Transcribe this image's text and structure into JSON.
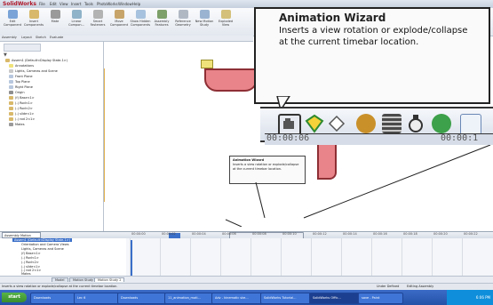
{
  "window": {
    "app_name": "SolidWorks",
    "menus": [
      "File",
      "Edit",
      "View",
      "Insert",
      "Tools",
      "PhotoWorks",
      "Window",
      "Help"
    ]
  },
  "command_manager": {
    "buttons": [
      {
        "label": "Edit Component"
      },
      {
        "label": "Insert Components"
      },
      {
        "label": "Mate"
      },
      {
        "label": "Linear Compon..."
      },
      {
        "label": "Smart Fasteners"
      },
      {
        "label": "Move Component"
      },
      {
        "label": "Show Hidden Components"
      },
      {
        "label": "Assembly Features"
      },
      {
        "label": "Reference Geometry"
      },
      {
        "label": "New Motion Study"
      },
      {
        "label": "Exploded View"
      }
    ],
    "tabs": [
      "Assembly",
      "Layout",
      "Sketch",
      "Evaluate"
    ]
  },
  "feature_tree": {
    "root": "Assem1 (Default<Display State-1>)",
    "items": [
      "Annotations",
      "Lights, Cameras and Scene",
      "Front Plane",
      "Top Plane",
      "Right Plane",
      "Origin",
      "(f) Base<1>",
      "(-) Rod<1>",
      "(-) Rod<2>",
      "(-) slide<1>",
      "(-) rod 2<1>",
      "Mates"
    ]
  },
  "callouts": {
    "big": {
      "title": "Animation Wizard",
      "description": "Inserts a view rotation or explode/collapse at the current timebar location."
    },
    "small": {
      "title": "Animation Wizard",
      "description": "Inserts a view rotation or explode/collapse at the current timebar location."
    }
  },
  "timebar_big_labels": [
    "00:00:06",
    "00:00:1"
  ],
  "motion_study": {
    "study_type": "Assembly Motion",
    "timeline_labels": [
      "00:00:00",
      "00:00:02",
      "00:00:04",
      "00:00:06",
      "00:00:08",
      "00:00:10",
      "00:00:12",
      "00:00:14",
      "00:00:16",
      "00:00:18",
      "00:00:20",
      "00:00:22"
    ],
    "root": "Assem1 (Default<Display State-1>)",
    "items": [
      "Orientation and Camera Views",
      "Lights, Cameras and Scene",
      "(f) Base<1>",
      "(-) Rod<1>",
      "(-) Rod<2>",
      "(-) slide<1>",
      "(-) rod 2<1>",
      "Mates"
    ]
  },
  "bottom_tabs": [
    "Model",
    "Motion Study 1",
    "Motion Study 2"
  ],
  "status": {
    "message": "Inserts a view rotation or explode/collapse at the current timebar location.",
    "right": [
      "Under Defined",
      "Editing Assembly"
    ]
  },
  "taskbar": {
    "start": "start",
    "tasks": [
      "Downloads",
      "Lec 6",
      "Downloads",
      "11_animation_moti...",
      "Adv - kinematic ske...",
      "SolidWorks Tutorial...",
      "SolidWorks Offic...",
      "save - Paint"
    ],
    "clock": "6:06 PM"
  },
  "colors": {
    "accent": "#2452a8",
    "part_pink": "#e8848a",
    "part_yellow": "#f0e27a"
  }
}
